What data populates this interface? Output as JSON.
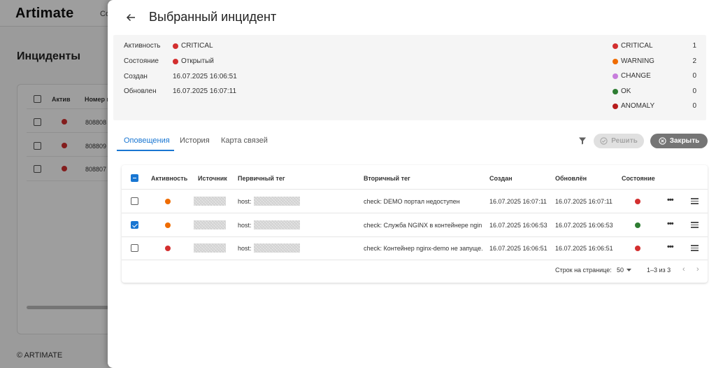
{
  "background": {
    "logo": "Artimate",
    "nav_partial": "Co",
    "page_title": "Инциденты",
    "table_headers": [
      "Актив",
      "Номер и"
    ],
    "rows": [
      {
        "number": "808808"
      },
      {
        "number": "808809"
      },
      {
        "number": "808807"
      }
    ],
    "footer": "© ARTIMATE"
  },
  "drawer": {
    "title": "Выбранный инцидент",
    "summary": {
      "activity_label": "Активность",
      "activity_value": "CRITICAL",
      "state_label": "Состояние",
      "state_value": "Открытый",
      "created_label": "Создан",
      "created_value": "16.07.2025 16:06:51",
      "updated_label": "Обновлен",
      "updated_value": "16.07.2025 16:07:11"
    },
    "severity_counts": [
      {
        "name": "CRITICAL",
        "count": "1",
        "color": "#d32f2f"
      },
      {
        "name": "WARNING",
        "count": "2",
        "color": "#ef6c00"
      },
      {
        "name": "CHANGE",
        "count": "0",
        "color": "#c77ddc"
      },
      {
        "name": "OK",
        "count": "0",
        "color": "#2e7d32"
      },
      {
        "name": "ANOMALY",
        "count": "0",
        "color": "#b71c1c"
      }
    ],
    "tabs": [
      "Оповещения",
      "История",
      "Карта связей"
    ],
    "active_tab": "Оповещения",
    "resolve_label": "Решить",
    "close_label": "Закрыть",
    "table": {
      "headers": {
        "activity": "Активность",
        "source": "Источник",
        "primary_tag": "Первичный тег",
        "secondary_tag": "Вторичный тег",
        "created": "Создан",
        "updated": "Обновлён",
        "state": "Состояние"
      },
      "rows": [
        {
          "checked": false,
          "activity_color": "#ef6c00",
          "primary_prefix": "host:",
          "secondary": "check: DEMO портал недоступен",
          "created": "16.07.2025 16:07:11",
          "updated": "16.07.2025 16:07:11",
          "state_color": "#d32f2f"
        },
        {
          "checked": true,
          "activity_color": "#ef6c00",
          "primary_prefix": "host:",
          "secondary": "check: Служба NGINX в контейнере ngin...",
          "created": "16.07.2025 16:06:53",
          "updated": "16.07.2025 16:06:53",
          "state_color": "#2e7d32"
        },
        {
          "checked": false,
          "activity_color": "#d32f2f",
          "primary_prefix": "host:",
          "secondary": "check: Контейнер nginx-demo не запуще...",
          "created": "16.07.2025 16:06:51",
          "updated": "16.07.2025 16:06:51",
          "state_color": "#d32f2f"
        }
      ],
      "pagination": {
        "rows_per_page_label": "Строк на странице:",
        "rows_per_page_value": "50",
        "range": "1–3 из 3"
      }
    }
  }
}
